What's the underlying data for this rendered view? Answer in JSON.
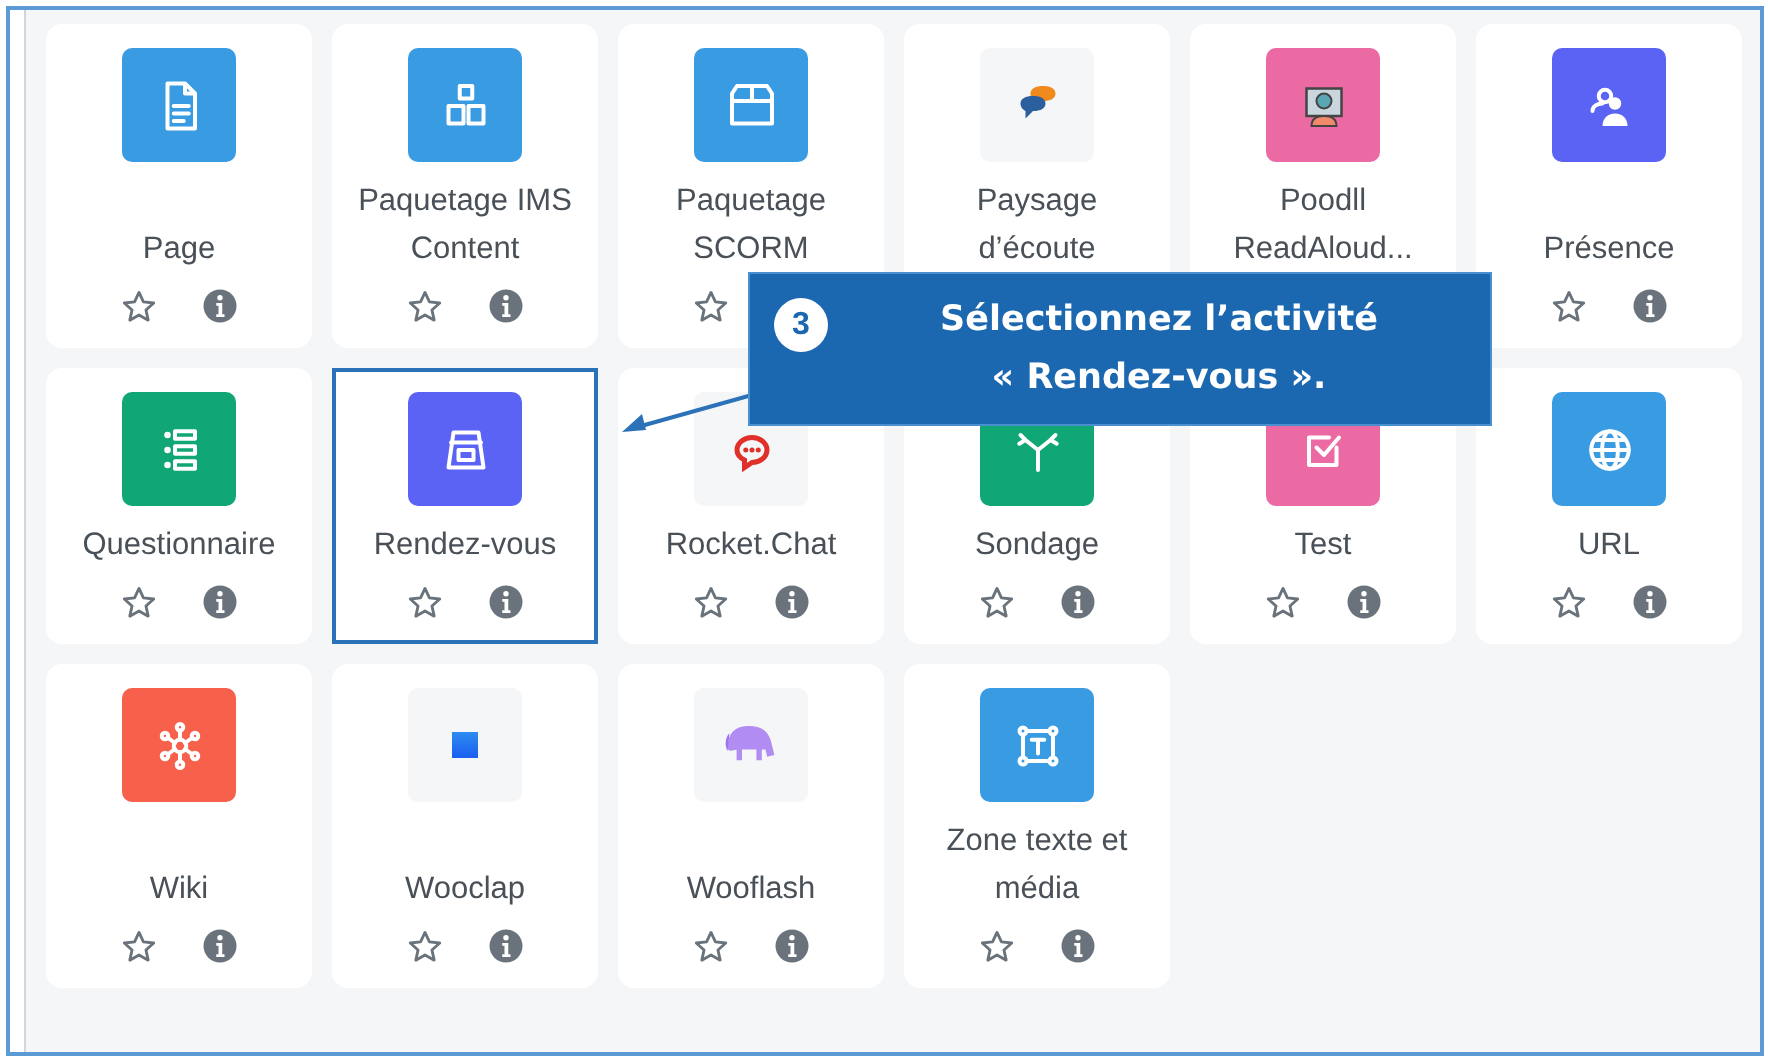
{
  "activities": [
    {
      "name": "Page",
      "kind": "page",
      "color": "#399be2",
      "highlighted": false
    },
    {
      "name": "Paquetage IMS Content",
      "kind": "boxes",
      "color": "#399be2",
      "highlighted": false
    },
    {
      "name": "Paquetage SCORM",
      "kind": "box",
      "color": "#399be2",
      "highlighted": false
    },
    {
      "name": "Paysage d’écoute",
      "kind": "bubbles",
      "color": "#f5f6f8",
      "highlighted": false
    },
    {
      "name": "Poodll ReadAloud...",
      "kind": "reader",
      "color": "#ec6aa3",
      "highlighted": false
    },
    {
      "name": "Présence",
      "kind": "people",
      "color": "#5b63f5",
      "highlighted": false
    },
    {
      "name": "Questionnaire",
      "kind": "list",
      "color": "#11a676",
      "highlighted": false
    },
    {
      "name": "Rendez-vous",
      "kind": "calendar",
      "color": "#5b63f5",
      "highlighted": true
    },
    {
      "name": "Rocket.Chat",
      "kind": "chat",
      "color": "#f5f6f8",
      "highlighted": false
    },
    {
      "name": "Sondage",
      "kind": "split",
      "color": "#11a676",
      "highlighted": false
    },
    {
      "name": "Test",
      "kind": "check",
      "color": "#ec6aa3",
      "highlighted": false
    },
    {
      "name": "URL",
      "kind": "globe",
      "color": "#399be2",
      "highlighted": false
    },
    {
      "name": "Wiki",
      "kind": "network",
      "color": "#f7604a",
      "highlighted": false
    },
    {
      "name": "Wooclap",
      "kind": "square",
      "color": "#f5f6f8",
      "highlighted": false
    },
    {
      "name": "Wooflash",
      "kind": "elephant",
      "color": "#f5f6f8",
      "highlighted": false
    },
    {
      "name": "Zone texte et média",
      "kind": "frame",
      "color": "#399be2",
      "highlighted": false
    }
  ],
  "callout": {
    "step": "3",
    "lines": [
      "Sélectionnez l’activité",
      "« Rendez-vous »."
    ]
  }
}
